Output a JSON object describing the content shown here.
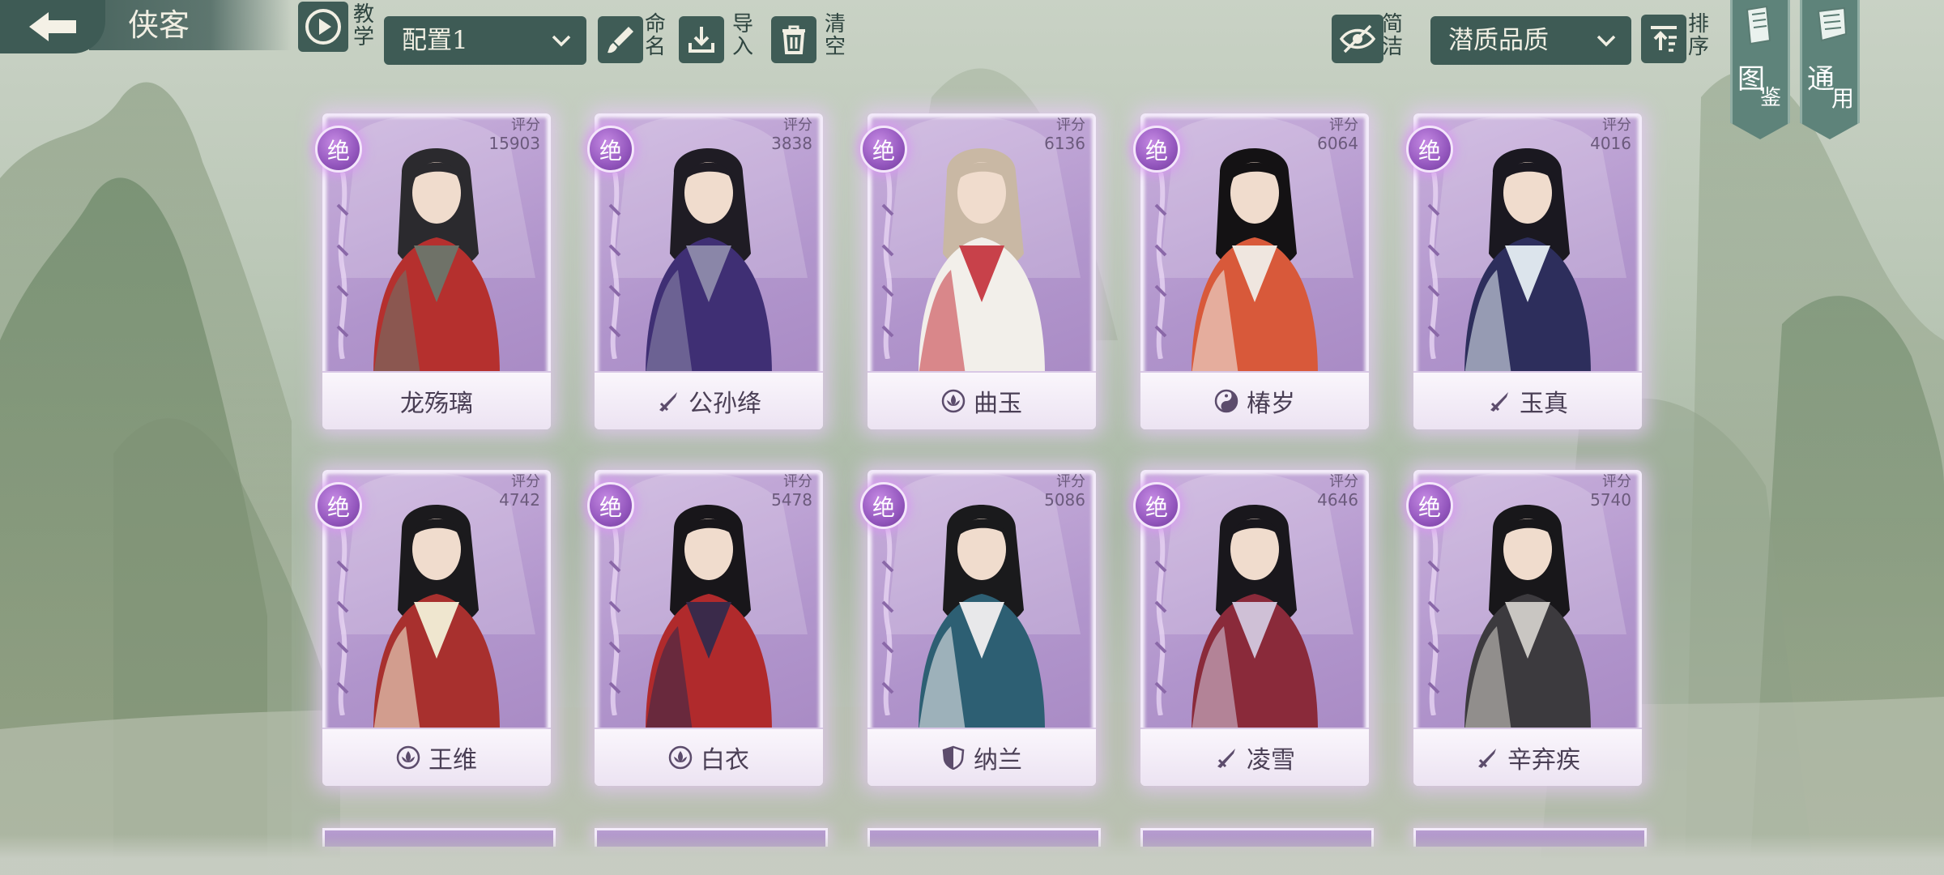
{
  "header": {
    "title": "侠客",
    "tutorial_label_1": "教",
    "tutorial_label_2": "学",
    "config_select": "配置1",
    "rename_1": "命",
    "rename_2": "名",
    "import_1": "导",
    "import_2": "入",
    "clear_1": "清",
    "clear_2": "空",
    "simple_1": "简",
    "simple_2": "洁",
    "sort_select": "潜质品质",
    "sort_1": "排",
    "sort_2": "序",
    "codex_1": "图",
    "codex_2": "鉴",
    "general_1": "通",
    "general_2": "用"
  },
  "colors": {
    "accent_dark": "#3e5b55",
    "card_purple": "#b195cc",
    "badge_purple": "#9457be",
    "name_text": "#4a3f55"
  },
  "score_label": "评分",
  "cards": [
    {
      "name": "龙殇璃",
      "rank": "绝",
      "score": "15903",
      "school_icon": "",
      "palette": [
        "#2b2a2e",
        "#b5302e",
        "#6f7268"
      ]
    },
    {
      "name": "公孙绛",
      "rank": "绝",
      "score": "3838",
      "school_icon": "sword-icon",
      "palette": [
        "#1f1c24",
        "#3f2f74",
        "#8a86a8"
      ]
    },
    {
      "name": "曲玉",
      "rank": "绝",
      "score": "6136",
      "school_icon": "lotus-icon",
      "palette": [
        "#c9b8a4",
        "#f2efea",
        "#c8414a"
      ]
    },
    {
      "name": "椿岁",
      "rank": "绝",
      "score": "6064",
      "school_icon": "yinyang-icon",
      "palette": [
        "#141214",
        "#d8593a",
        "#efe6df"
      ]
    },
    {
      "name": "玉真",
      "rank": "绝",
      "score": "4016",
      "school_icon": "sword-icon",
      "palette": [
        "#1a1820",
        "#2d2e5c",
        "#dce4ec"
      ]
    },
    {
      "name": "王维",
      "rank": "绝",
      "score": "4742",
      "school_icon": "lotus-icon",
      "palette": [
        "#1b1a1d",
        "#a8302e",
        "#efe6cf"
      ]
    },
    {
      "name": "白衣",
      "rank": "绝",
      "score": "5478",
      "school_icon": "lotus-icon",
      "palette": [
        "#18161a",
        "#b02a2c",
        "#3a2a4a"
      ]
    },
    {
      "name": "纳兰",
      "rank": "绝",
      "score": "5086",
      "school_icon": "shield-icon",
      "palette": [
        "#1a1a1c",
        "#2d5f73",
        "#e8e8ea"
      ]
    },
    {
      "name": "凌雪",
      "rank": "绝",
      "score": "4646",
      "school_icon": "sword-icon",
      "palette": [
        "#19171c",
        "#8a2a3a",
        "#cfc0d6"
      ]
    },
    {
      "name": "辛弃疾",
      "rank": "绝",
      "score": "5740",
      "school_icon": "sword-icon",
      "palette": [
        "#18171a",
        "#3c3a3e",
        "#c9c6c2"
      ]
    }
  ]
}
